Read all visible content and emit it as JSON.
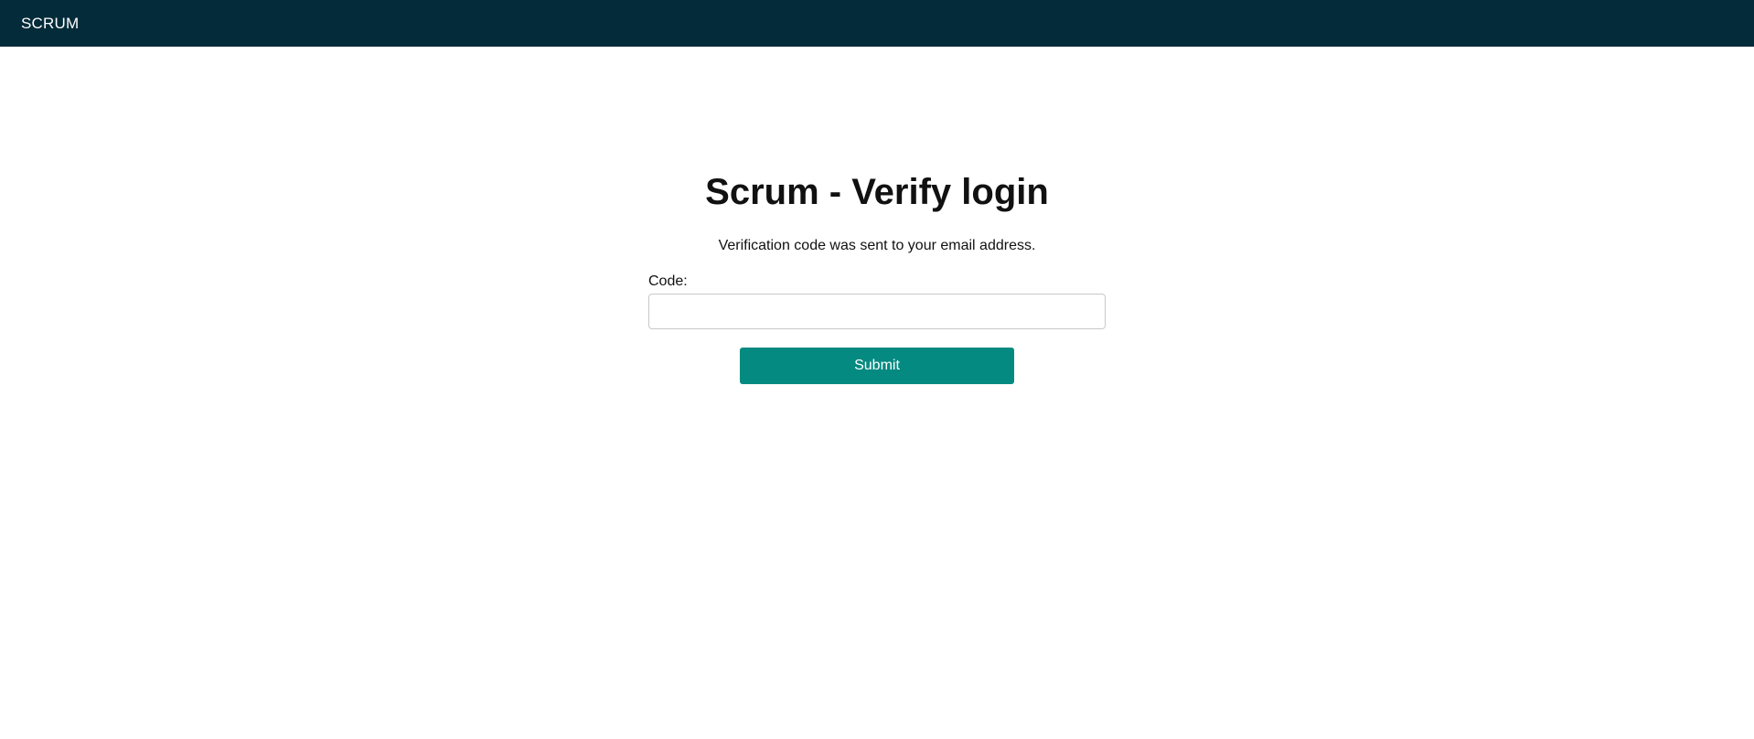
{
  "header": {
    "brand": "SCRUM"
  },
  "main": {
    "title": "Scrum - Verify login",
    "subtitle": "Verification code was sent to your email address.",
    "form": {
      "code_label": "Code:",
      "code_value": "",
      "code_placeholder": "",
      "submit_label": "Submit"
    }
  },
  "colors": {
    "header_background": "#032b39",
    "accent": "#048a80"
  }
}
